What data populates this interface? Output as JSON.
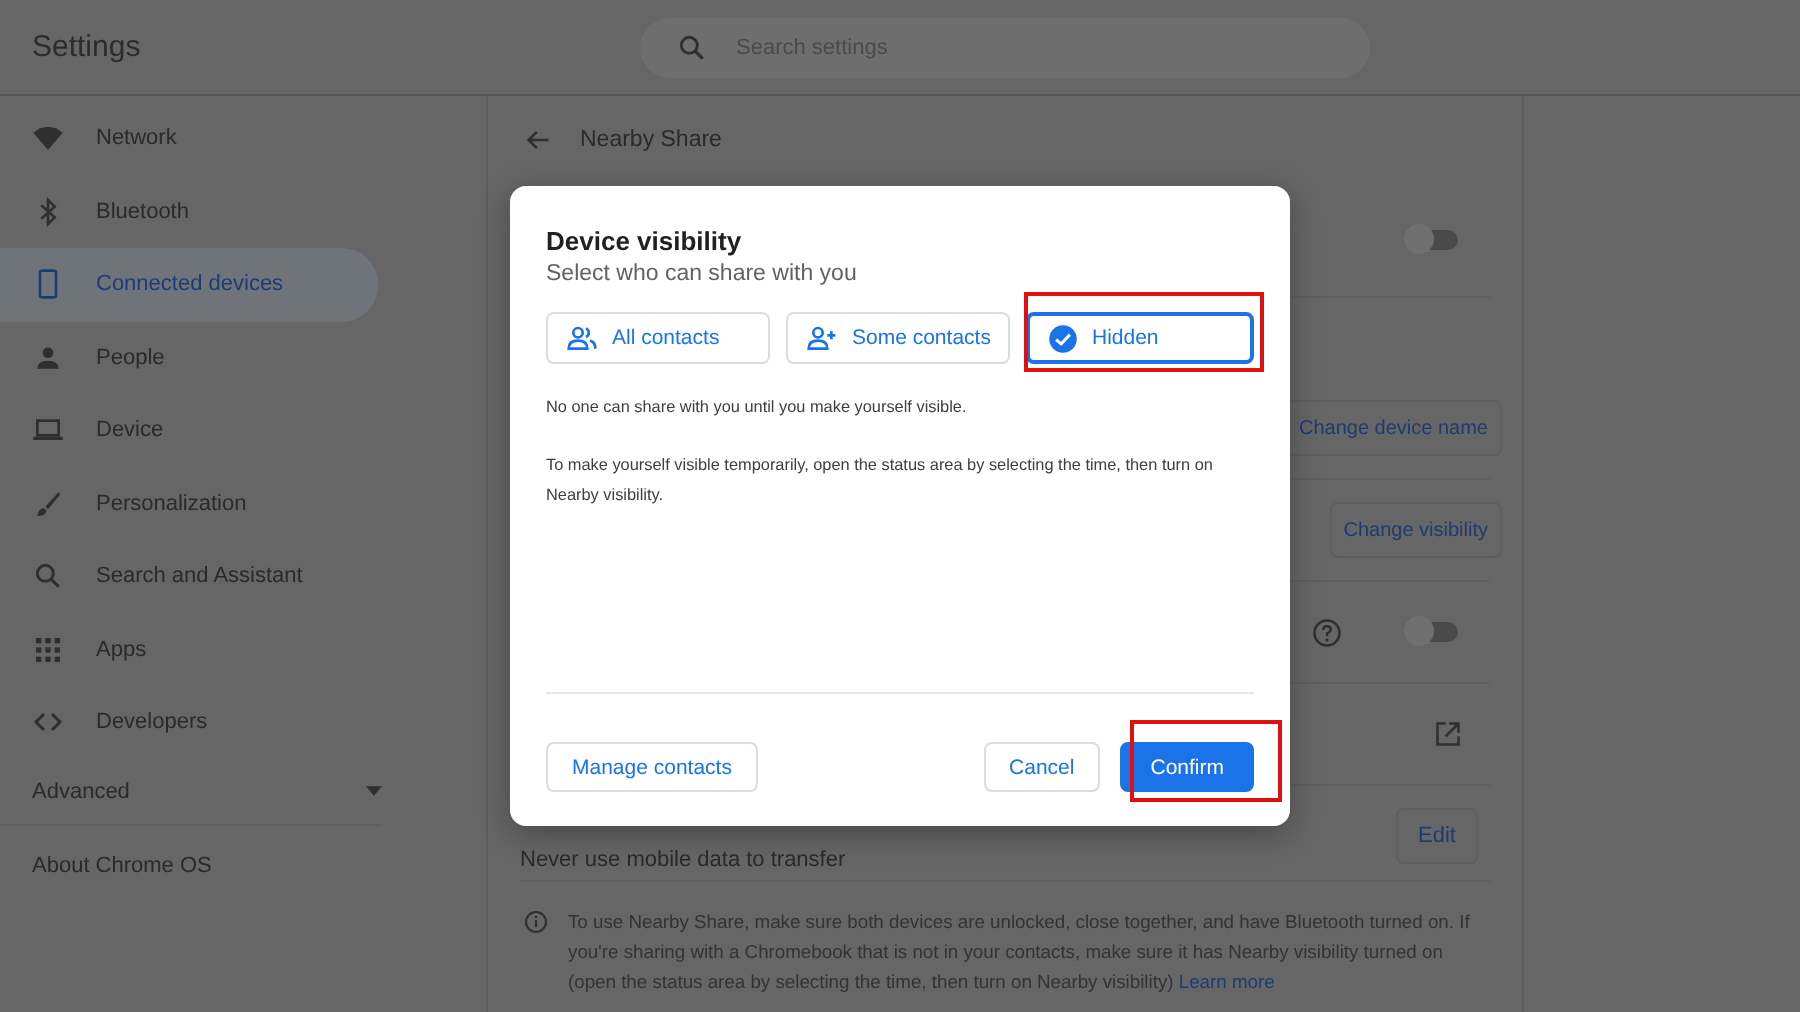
{
  "header": {
    "title": "Settings",
    "search": {
      "placeholder": "Search settings"
    }
  },
  "sidebar": {
    "items": [
      {
        "label": "Network",
        "selected": false
      },
      {
        "label": "Bluetooth",
        "selected": false
      },
      {
        "label": "Connected devices",
        "selected": true
      },
      {
        "label": "People",
        "selected": false
      },
      {
        "label": "Device",
        "selected": false
      },
      {
        "label": "Personalization",
        "selected": false
      },
      {
        "label": "Search and Assistant",
        "selected": false
      },
      {
        "label": "Apps",
        "selected": false
      },
      {
        "label": "Developers",
        "selected": false
      }
    ],
    "advanced": {
      "label": "Advanced",
      "expanded": false
    },
    "about": "About Chrome OS"
  },
  "page": {
    "title": "Nearby Share",
    "rows": [
      {
        "kind": "toggle",
        "on": false
      },
      {
        "kind": "button",
        "button": "Change device name"
      },
      {
        "kind": "button",
        "button": "Change visibility"
      },
      {
        "kind": "help-toggle",
        "on": false
      },
      {
        "kind": "external"
      },
      {
        "kind": "text-button",
        "text": "Never use mobile data to transfer",
        "button": "Edit"
      }
    ],
    "info": {
      "text": "To use Nearby Share, make sure both devices are unlocked, close together, and have Bluetooth turned on. If you're sharing with a Chromebook that is not in your contacts, make sure it has Nearby visibility turned on (open the status area by selecting the time, then turn on Nearby visibility)",
      "link": "Learn more"
    }
  },
  "dialog": {
    "title": "Device visibility",
    "subtitle": "Select who can share with you",
    "options": [
      {
        "label": "All contacts",
        "selected": false
      },
      {
        "label": "Some contacts",
        "selected": false
      },
      {
        "label": "Hidden",
        "selected": true
      }
    ],
    "notes": [
      "No one can share with you until you make yourself visible.",
      "To make yourself visible temporarily, open the status area by selecting the time, then turn on Nearby visibility."
    ],
    "manage": "Manage contacts",
    "cancel": "Cancel",
    "confirm": "Confirm"
  }
}
